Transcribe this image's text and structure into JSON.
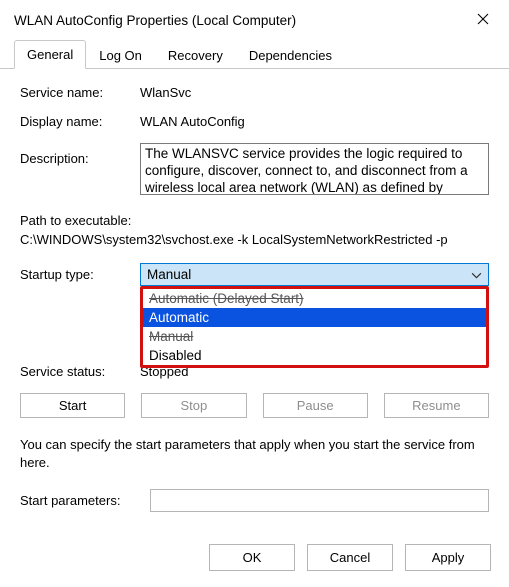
{
  "window": {
    "title": "WLAN AutoConfig Properties (Local Computer)"
  },
  "tabs": [
    {
      "label": "General"
    },
    {
      "label": "Log On"
    },
    {
      "label": "Recovery"
    },
    {
      "label": "Dependencies"
    }
  ],
  "labels": {
    "service_name": "Service name:",
    "display_name": "Display name:",
    "description": "Description:",
    "path_to_exe": "Path to executable:",
    "startup_type": "Startup type:",
    "service_status": "Service status:",
    "start_parameters": "Start parameters:"
  },
  "values": {
    "service_name": "WlanSvc",
    "display_name": "WLAN AutoConfig",
    "description": "The WLANSVC service provides the logic required to configure, discover, connect to, and disconnect from a wireless local area network (WLAN) as defined by",
    "path_to_exe": "C:\\WINDOWS\\system32\\svchost.exe -k LocalSystemNetworkRestricted -p",
    "startup_type_selected": "Manual",
    "service_status": "Stopped",
    "start_parameters": ""
  },
  "dropdown_options": [
    "Automatic (Delayed Start)",
    "Automatic",
    "Manual",
    "Disabled"
  ],
  "dropdown_highlighted_index": 1,
  "buttons": {
    "start": "Start",
    "stop": "Stop",
    "pause": "Pause",
    "resume": "Resume"
  },
  "help_text": "You can specify the start parameters that apply when you start the service from here.",
  "footer": {
    "ok": "OK",
    "cancel": "Cancel",
    "apply": "Apply"
  }
}
